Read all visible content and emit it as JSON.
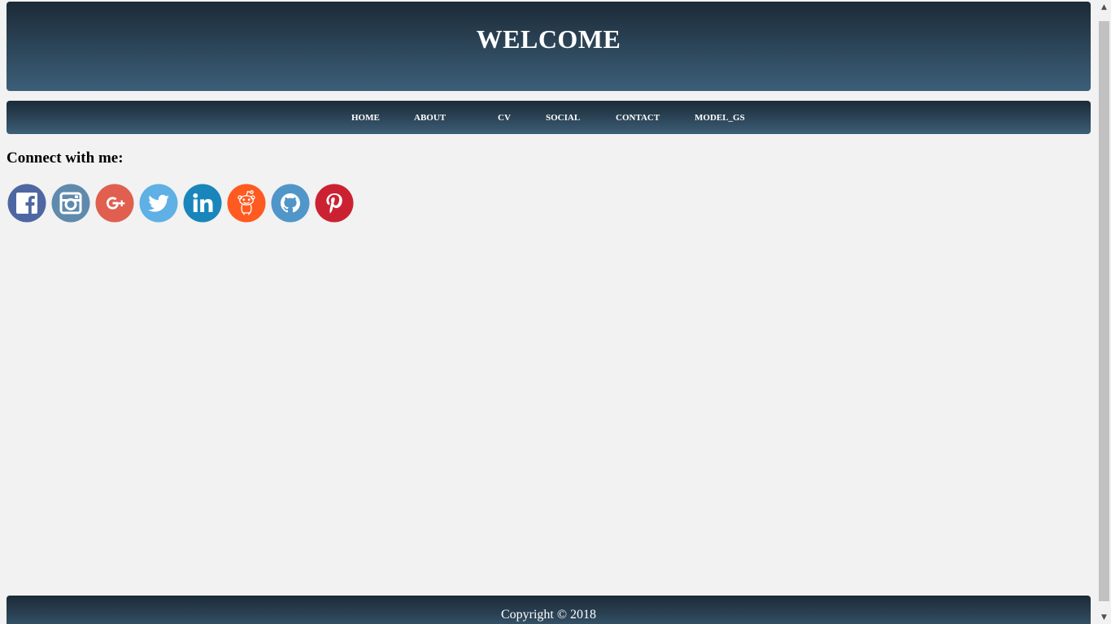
{
  "header": {
    "title": "WELCOME"
  },
  "nav": {
    "items": [
      {
        "label": "HOME"
      },
      {
        "label": "ABOUT"
      },
      {
        "label": "CV"
      },
      {
        "label": "SOCIAL"
      },
      {
        "label": "CONTACT"
      },
      {
        "label": "MODEL_GS"
      }
    ]
  },
  "connect": {
    "heading": "Connect with me:"
  },
  "social": [
    {
      "icon": "facebook-icon",
      "color": "#4e67a3"
    },
    {
      "icon": "instagram-icon",
      "color": "#5f8aac"
    },
    {
      "icon": "google-plus-icon",
      "color": "#e05f4f"
    },
    {
      "icon": "twitter-icon",
      "color": "#5eb0e5"
    },
    {
      "icon": "linkedin-icon",
      "color": "#1886bb"
    },
    {
      "icon": "reddit-icon",
      "color": "#ff5a1f"
    },
    {
      "icon": "github-icon",
      "color": "#5196c9"
    },
    {
      "icon": "pinterest-icon",
      "color": "#cb2233"
    }
  ],
  "footer": {
    "copyright": "Copyright © 2018"
  }
}
